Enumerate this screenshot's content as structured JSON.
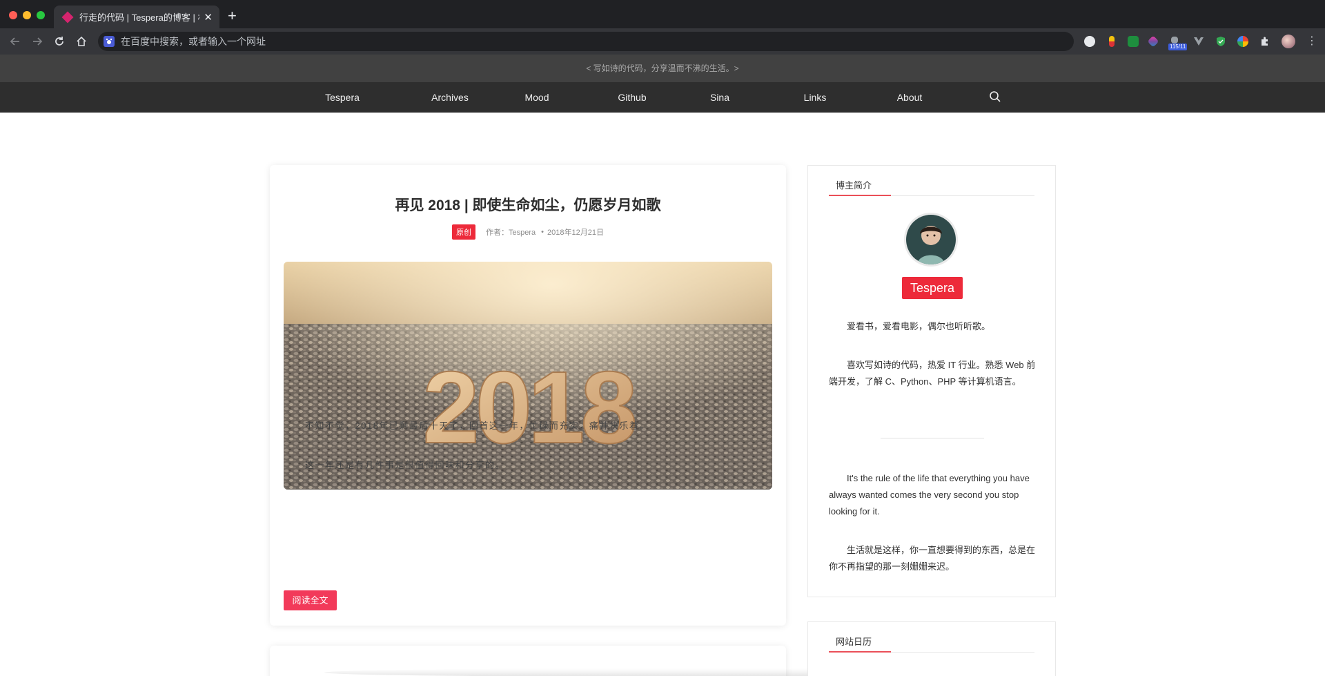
{
  "browser": {
    "tab_title": "行走的代码 | Tespera的博客 | 林",
    "address_placeholder": "在百度中搜索，或者输入一个网址",
    "extension_badge": "115/11"
  },
  "site": {
    "slogan": "< 写如诗的代码，分享温而不沸的生活。>",
    "nav": [
      "Tespera",
      "Archives",
      "Mood",
      "Github",
      "Sina",
      "Links",
      "About"
    ]
  },
  "post": {
    "title": "再见 2018 | 即使生命如尘，仍愿岁月如歌",
    "badge": "原创",
    "author": "作者：Tespera",
    "date": "2018年12月21日",
    "image_text": "2018",
    "paragraph_1": "不知不觉，2018年已剩最后十天了，回首这一年，忙碌而充实，痛并快乐着。",
    "paragraph_2": "这一年还是有几件事是很值得回味和分享的。",
    "read_more": "阅读全文"
  },
  "sidebar": {
    "profile_title": "博主简介",
    "profile_name": "Tespera",
    "bio_1": "爱看书，爱看电影，偶尔也听听歌。",
    "bio_2": "喜欢写如诗的代码，热爱 IT 行业。熟悉 Web 前端开发，了解 C、Python、PHP 等计算机语言。",
    "bio_3": "It's the rule of the life that everything you have always wanted comes the very second you stop looking for it.",
    "bio_4": "生活就是这样，你一直想要得到的东西，总是在你不再指望的那一刻姗姗来迟。",
    "calendar_title": "网站日历"
  },
  "colors": {
    "accent_red": "#ed2a3a",
    "read_more_pink": "#f23a5a",
    "nav_bg": "#2e2e2e",
    "slogan_bg": "#414141"
  }
}
